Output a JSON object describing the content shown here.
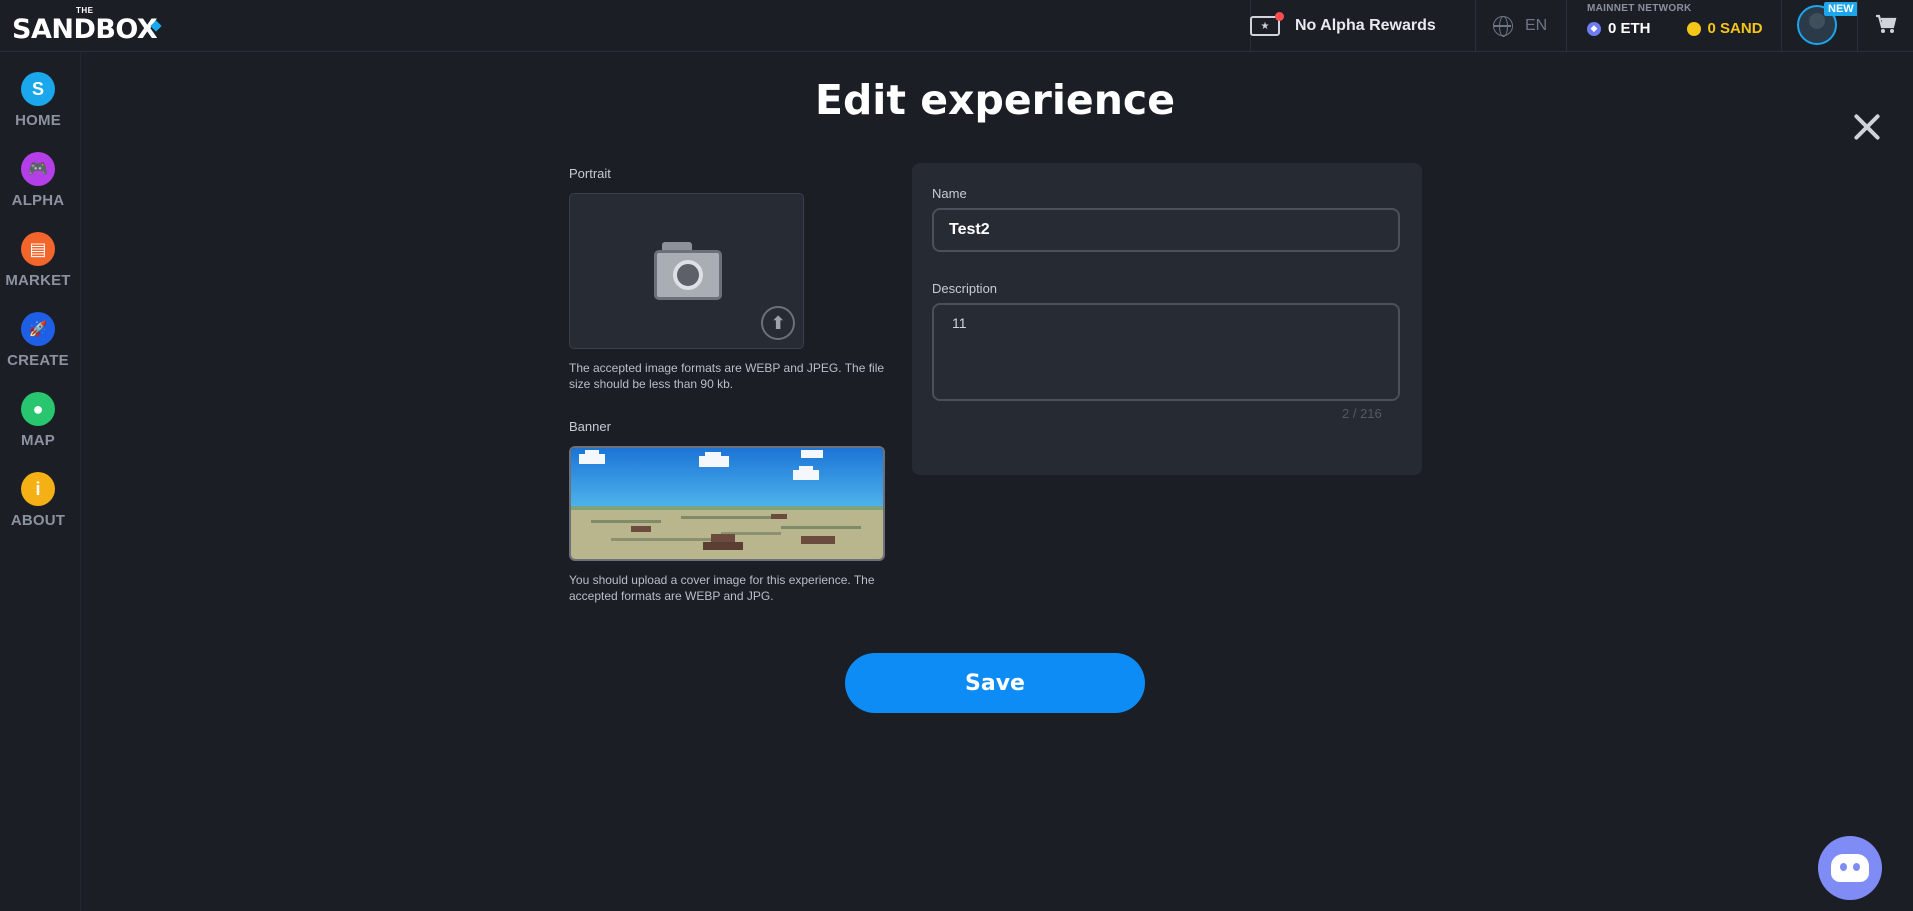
{
  "header": {
    "logo_small": "THE",
    "logo_text": "SANDBOX",
    "rewards_label": "No Alpha Rewards",
    "language": "EN",
    "network_label": "MAINNET NETWORK",
    "eth_balance": "0 ETH",
    "sand_balance": "0 SAND",
    "new_badge": "NEW"
  },
  "sidebar": {
    "items": [
      {
        "label": "HOME",
        "icon": "S",
        "color": "#1aa7ec"
      },
      {
        "label": "ALPHA",
        "icon": "🎮",
        "color": "#b43fe8"
      },
      {
        "label": "MARKET",
        "icon": "▤",
        "color": "#f3652b"
      },
      {
        "label": "CREATE",
        "icon": "🚀",
        "color": "#1e5fe6"
      },
      {
        "label": "MAP",
        "icon": "●",
        "color": "#28c76f"
      },
      {
        "label": "ABOUT",
        "icon": "i",
        "color": "#f5b015"
      }
    ]
  },
  "main": {
    "title": "Edit experience",
    "portrait_label": "Portrait",
    "portrait_help": "The accepted image formats are WEBP and JPEG. The file size should be less than 90 kb.",
    "banner_label": "Banner",
    "banner_help": "You should upload a cover image for this experience. The accepted formats are WEBP and JPG.",
    "name_label": "Name",
    "name_value": "Test2",
    "description_label": "Description",
    "description_value": "11",
    "char_counter": "2 / 216",
    "save_label": "Save"
  },
  "colors": {
    "accent": "#0c8cf4",
    "background": "#1b1e25",
    "sand": "#f5c518"
  }
}
